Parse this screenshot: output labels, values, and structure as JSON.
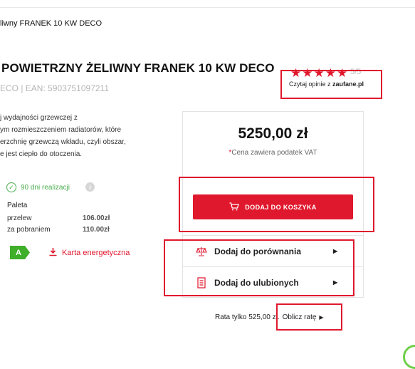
{
  "breadcrumb": "liwny FRANEK 10 KW DECO",
  "product": {
    "title": "POWIETRZNY ŻELIWNY FRANEK 10 KW DECO",
    "code_ean": "ECO | EAN: 5903751097211"
  },
  "rating": {
    "stars": "★★★★★",
    "score": "5/5",
    "reviews_prefix": "Czytaj opinie z",
    "reviews_source": "zaufane.pl"
  },
  "description": [
    "j wydajności grzewczej z",
    "ym rozmieszczeniem radiatorów, które",
    "erzchnię grzewczą wkładu, czyli obszar,",
    "e jest ciepło do otoczenia."
  ],
  "availability": "90 dni realizacji",
  "shipping": {
    "title": "Paleta",
    "rows": [
      {
        "label": "przelew",
        "value": "106.00zł"
      },
      {
        "label": "za pobraniem",
        "value": "110.00zł"
      }
    ]
  },
  "energy": {
    "class": "A",
    "link_label": "Karta energetyczna"
  },
  "purchase": {
    "price": "5250,00 zł",
    "vat_asterisk": "*",
    "vat_note": "Cena zawiera podatek VAT",
    "add_to_cart": "DODAJ DO KOSZYKA",
    "compare": "Dodaj do porównania",
    "favorites": "Dodaj do ulubionych"
  },
  "installment": {
    "text": "Rata tylko 525,00 zł.",
    "link": "Oblicz ratę"
  },
  "icons": {
    "availability": "check-circle-icon",
    "info": "info-icon",
    "energy": "download-icon",
    "cart": "cart-icon",
    "compare": "scales-icon",
    "favorites": "list-icon",
    "arrow": "caret-right-icon"
  },
  "colors": {
    "accent": "#e0182d",
    "available": "#4caf50",
    "energy_class": "#3fae29"
  }
}
